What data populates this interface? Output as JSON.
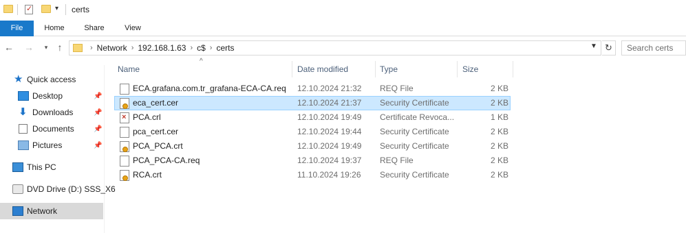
{
  "window": {
    "title": "certs"
  },
  "ribbon": {
    "tabs": [
      "File",
      "Home",
      "Share",
      "View"
    ]
  },
  "address": {
    "crumbs": [
      "Network",
      "192.168.1.63",
      "c$",
      "certs"
    ],
    "search_placeholder": "Search certs"
  },
  "sidebar": {
    "quick_access": "Quick access",
    "desktop": "Desktop",
    "downloads": "Downloads",
    "documents": "Documents",
    "pictures": "Pictures",
    "this_pc": "This PC",
    "dvd": "DVD Drive (D:) SSS_X6",
    "network": "Network"
  },
  "columns": {
    "name": "Name",
    "date": "Date modified",
    "type": "Type",
    "size": "Size"
  },
  "files": [
    {
      "name": "ECA.grafana.com.tr_grafana-ECA-CA.req",
      "date": "12.10.2024 21:32",
      "type": "REQ File",
      "size": "2 KB",
      "icon": "doc"
    },
    {
      "name": "eca_cert.cer",
      "date": "12.10.2024 21:37",
      "type": "Security Certificate",
      "size": "2 KB",
      "icon": "cert"
    },
    {
      "name": "PCA.crl",
      "date": "12.10.2024 19:49",
      "type": "Certificate Revoca...",
      "size": "1 KB",
      "icon": "crl"
    },
    {
      "name": "pca_cert.cer",
      "date": "12.10.2024 19:44",
      "type": "Security Certificate",
      "size": "2 KB",
      "icon": "cert"
    },
    {
      "name": "PCA_PCA.crt",
      "date": "12.10.2024 19:49",
      "type": "Security Certificate",
      "size": "2 KB",
      "icon": "cert"
    },
    {
      "name": "PCA_PCA-CA.req",
      "date": "12.10.2024 19:37",
      "type": "REQ File",
      "size": "2 KB",
      "icon": "doc"
    },
    {
      "name": "RCA.crt",
      "date": "11.10.2024 19:26",
      "type": "Security Certificate",
      "size": "2 KB",
      "icon": "cert"
    }
  ]
}
